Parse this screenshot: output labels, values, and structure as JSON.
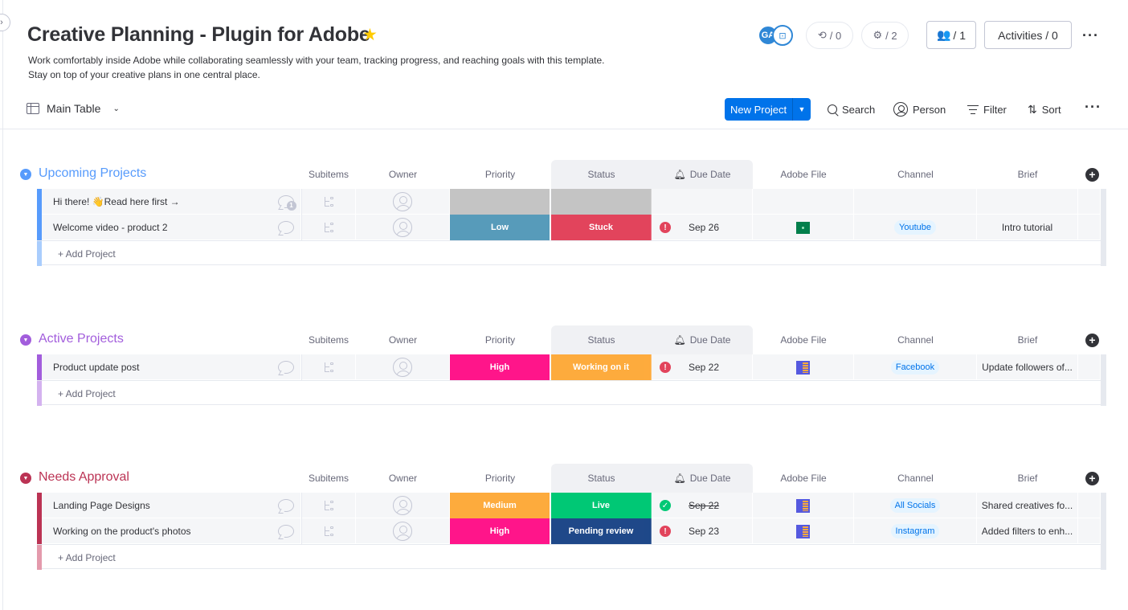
{
  "board": {
    "title": "Creative Planning - Plugin for Adobe",
    "description": "Work comfortably inside Adobe while collaborating seamlessly with your team, tracking progress, and reaching goals with this template. Stay on top of your creative plans in one central place."
  },
  "header": {
    "avatar_initials": "GA",
    "automations_count": "/ 0",
    "integrations_count": "/ 2",
    "members_count": "/ 1",
    "activities_label": "Activities / 0"
  },
  "toolbar": {
    "view_label": "Main Table",
    "new_project_label": "New Project",
    "search_label": "Search",
    "person_label": "Person",
    "filter_label": "Filter",
    "sort_label": "Sort"
  },
  "columns": {
    "subitems": "Subitems",
    "owner": "Owner",
    "priority": "Priority",
    "status": "Status",
    "due_date": "Due Date",
    "adobe_file": "Adobe File",
    "channel": "Channel",
    "brief": "Brief"
  },
  "add_row_label": "+ Add Project",
  "groups": [
    {
      "title": "Upcoming Projects",
      "color": "#579bfc",
      "light": "#a9cdfd",
      "rows": [
        {
          "name": "Hi there! 👋Read here first →",
          "chat_badge": "1",
          "priority": "",
          "priority_color": "#c4c4c4",
          "status": "",
          "status_color": "#c4c4c4",
          "due_state": "",
          "due": "",
          "adobe": "",
          "channel": "",
          "brief": ""
        },
        {
          "name": "Welcome video - product 2",
          "chat_badge": "",
          "priority": "Low",
          "priority_color": "#579bba",
          "status": "Stuck",
          "status_color": "#e2445c",
          "due_state": "warn",
          "due": "Sep 26",
          "adobe": "green",
          "channel": "Youtube",
          "brief": "Intro tutorial"
        }
      ]
    },
    {
      "title": "Active Projects",
      "color": "#a25ddc",
      "light": "#d4b2ef",
      "rows": [
        {
          "name": "Product update post",
          "chat_badge": "",
          "priority": "High",
          "priority_color": "#ff158a",
          "status": "Working on it",
          "status_color": "#fdab3d",
          "due_state": "warn",
          "due": "Sep 22",
          "adobe": "file",
          "channel": "Facebook",
          "brief": "Update followers of..."
        }
      ]
    },
    {
      "title": "Needs Approval",
      "color": "#bb3354",
      "light": "#e49aac",
      "rows": [
        {
          "name": "Landing Page Designs",
          "chat_badge": "",
          "priority": "Medium",
          "priority_color": "#fdab3d",
          "status": "Live",
          "status_color": "#00c875",
          "due_state": "done",
          "due": "Sep 22",
          "adobe": "file",
          "channel": "All Socials",
          "brief": "Shared creatives fo..."
        },
        {
          "name": "Working on the product's photos",
          "chat_badge": "",
          "priority": "High",
          "priority_color": "#ff158a",
          "status": "Pending review",
          "status_color": "#1f4889",
          "due_state": "warn",
          "due": "Sep 23",
          "adobe": "file",
          "channel": "Instagram",
          "brief": "Added filters to enh..."
        }
      ]
    }
  ]
}
